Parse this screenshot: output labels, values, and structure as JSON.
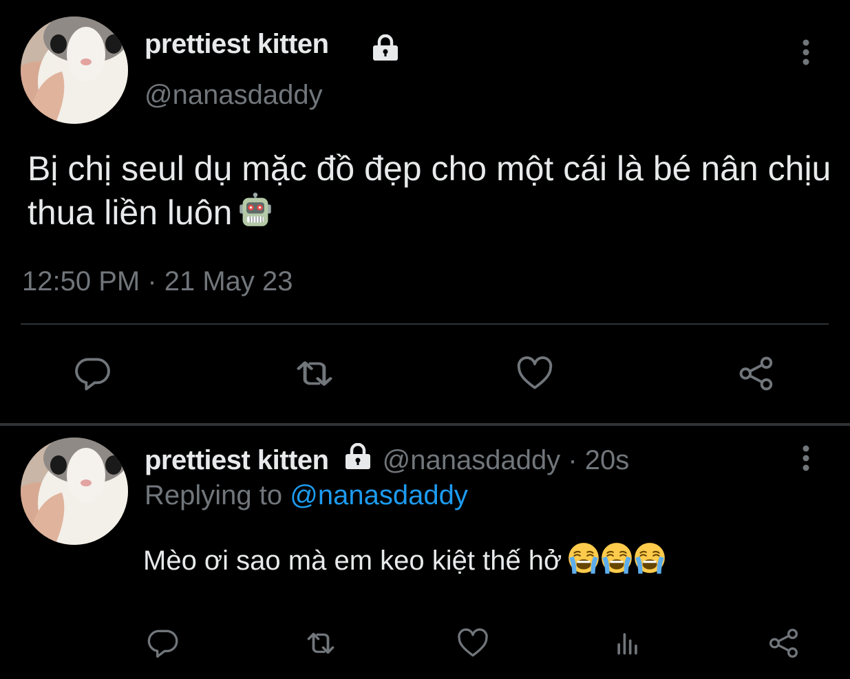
{
  "main_tweet": {
    "display_name": "prettiest kitten",
    "handle": "@nanasdaddy",
    "text": "Bị chị seul dụ mặc đồ đẹp cho một cái là bé nân chịu thua liền luôn",
    "emoji": "robot-face",
    "timestamp": "12:50 PM · 21 May 23",
    "actions": [
      "reply",
      "retweet",
      "like",
      "share"
    ]
  },
  "reply_tweet": {
    "display_name": "prettiest kitten",
    "handle": "@nanasdaddy",
    "separator": "·",
    "time": "20s",
    "replying_prefix": "Replying to",
    "replying_to": "@nanasdaddy",
    "text": "Mèo ơi sao mà em keo kiệt thế hở",
    "emojis": [
      "loudly-crying-face",
      "loudly-crying-face",
      "loudly-crying-face"
    ],
    "actions": [
      "reply",
      "retweet",
      "like",
      "views",
      "share"
    ]
  },
  "colors": {
    "background": "#000000",
    "primary_text": "#e7e9ea",
    "secondary_text": "#71767b",
    "link": "#1d9bf0",
    "divider": "#2f3336"
  }
}
